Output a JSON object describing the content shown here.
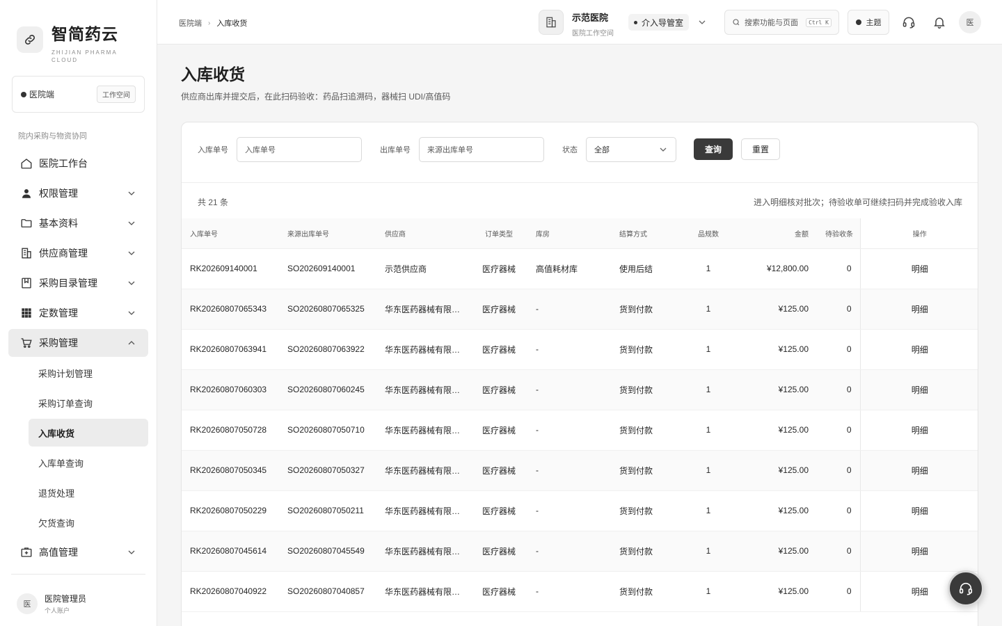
{
  "brand": {
    "title": "智简药云",
    "subtitle": "ZHIJIAN PHARMA CLOUD"
  },
  "workspace": {
    "label": "医院端",
    "button": "工作空间"
  },
  "sidebar": {
    "section_title": "院内采购与物资协同",
    "items": [
      {
        "label": "医院工作台",
        "icon": "home-icon"
      },
      {
        "label": "权限管理",
        "icon": "user-icon"
      },
      {
        "label": "基本资料",
        "icon": "folder-icon"
      },
      {
        "label": "供应商管理",
        "icon": "building-icon"
      },
      {
        "label": "采购目录管理",
        "icon": "bookmark-icon"
      },
      {
        "label": "定数管理",
        "icon": "grid-icon"
      },
      {
        "label": "采购管理",
        "icon": "cart-icon"
      },
      {
        "label": "高值管理",
        "icon": "medical-box-icon"
      }
    ],
    "sub_items": [
      {
        "label": "采购计划管理"
      },
      {
        "label": "采购订单查询"
      },
      {
        "label": "入库收货"
      },
      {
        "label": "入库单查询"
      },
      {
        "label": "退货处理"
      },
      {
        "label": "欠货查询"
      }
    ],
    "active_sub": "入库收货"
  },
  "user": {
    "avatar": "医",
    "name": "医院管理员",
    "role": "个人账户"
  },
  "header": {
    "breadcrumb": [
      "医院端",
      "入库收货"
    ],
    "hospital_name": "示范医院",
    "hospital_sub": "医院工作空间",
    "role": "介入导管室",
    "search_placeholder": "搜索功能与页面",
    "search_shortcut": "Ctrl K",
    "theme_label": "主题",
    "avatar": "医"
  },
  "page": {
    "title": "入库收货",
    "description": "供应商出库并提交后，在此扫码验收：药品扫追溯码，器械扫 UDI/高值码"
  },
  "filters": {
    "inbound_label": "入库单号",
    "inbound_placeholder": "入库单号",
    "outbound_label": "出库单号",
    "outbound_placeholder": "来源出库单号",
    "status_label": "状态",
    "status_value": "全部",
    "query_button": "查询",
    "reset_button": "重置"
  },
  "table": {
    "count_text": "共 21 条",
    "hint": "进入明细核对批次；待验收单可继续扫码并完成验收入库",
    "columns": [
      "入库单号",
      "来源出库单号",
      "供应商",
      "订单类型",
      "库房",
      "结算方式",
      "品规数",
      "金额",
      "待验收条",
      "操作"
    ],
    "rows": [
      [
        "RK202609140001",
        "SO202609140001",
        "示范供应商",
        "医疗器械",
        "高值耗材库",
        "使用后结",
        "1",
        "¥12,800.00",
        "0",
        "明细"
      ],
      [
        "RK20260807065343",
        "SO20260807065325",
        "华东医药器械有限…",
        "医疗器械",
        "-",
        "货到付款",
        "1",
        "¥125.00",
        "0",
        "明细"
      ],
      [
        "RK20260807063941",
        "SO20260807063922",
        "华东医药器械有限…",
        "医疗器械",
        "-",
        "货到付款",
        "1",
        "¥125.00",
        "0",
        "明细"
      ],
      [
        "RK20260807060303",
        "SO20260807060245",
        "华东医药器械有限…",
        "医疗器械",
        "-",
        "货到付款",
        "1",
        "¥125.00",
        "0",
        "明细"
      ],
      [
        "RK20260807050728",
        "SO20260807050710",
        "华东医药器械有限…",
        "医疗器械",
        "-",
        "货到付款",
        "1",
        "¥125.00",
        "0",
        "明细"
      ],
      [
        "RK20260807050345",
        "SO20260807050327",
        "华东医药器械有限…",
        "医疗器械",
        "-",
        "货到付款",
        "1",
        "¥125.00",
        "0",
        "明细"
      ],
      [
        "RK20260807050229",
        "SO20260807050211",
        "华东医药器械有限…",
        "医疗器械",
        "-",
        "货到付款",
        "1",
        "¥125.00",
        "0",
        "明细"
      ],
      [
        "RK20260807045614",
        "SO20260807045549",
        "华东医药器械有限…",
        "医疗器械",
        "-",
        "货到付款",
        "1",
        "¥125.00",
        "0",
        "明细"
      ],
      [
        "RK20260807040922",
        "SO20260807040857",
        "华东医药器械有限…",
        "医疗器械",
        "-",
        "货到付款",
        "1",
        "¥125.00",
        "0",
        "明细"
      ]
    ]
  },
  "float_button_icon": "headset-icon"
}
